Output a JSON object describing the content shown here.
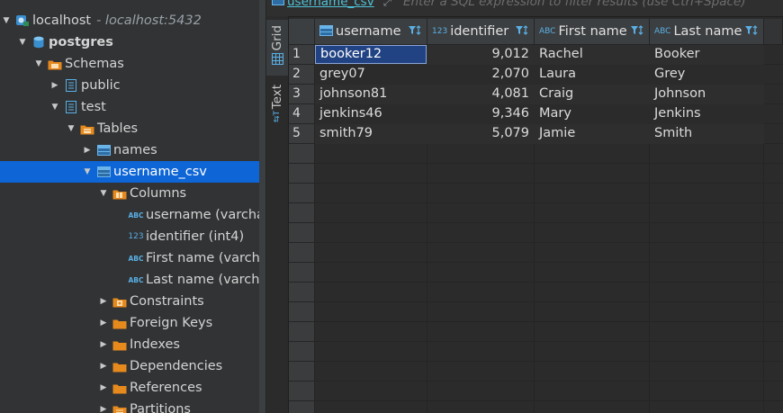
{
  "navigator": {
    "nodes": [
      {
        "label": "localhost",
        "sub": "- localhost:5432",
        "level": 0,
        "arrow": "down",
        "icon": "server-icon"
      },
      {
        "label": "postgres",
        "level": 1,
        "arrow": "down",
        "icon": "database-icon",
        "bold": true
      },
      {
        "label": "Schemas",
        "level": 2,
        "arrow": "down",
        "icon": "schemas-folder-icon"
      },
      {
        "label": "public",
        "level": 3,
        "arrow": "right",
        "icon": "schema-icon"
      },
      {
        "label": "test",
        "level": 3,
        "arrow": "down",
        "icon": "schema-icon"
      },
      {
        "label": "Tables",
        "level": 4,
        "arrow": "down",
        "icon": "tables-folder-icon"
      },
      {
        "label": "names",
        "level": 5,
        "arrow": "right",
        "icon": "table-icon"
      },
      {
        "label": "username_csv",
        "level": 5,
        "arrow": "down",
        "icon": "table-icon",
        "selected": true
      },
      {
        "label": "Columns",
        "level": 6,
        "arrow": "down",
        "icon": "columns-folder-icon"
      },
      {
        "label": "username (varchar",
        "level": 7,
        "arrow": "none",
        "icon": "text-column-icon"
      },
      {
        "label": "identifier (int4)",
        "level": 7,
        "arrow": "none",
        "icon": "number-column-icon"
      },
      {
        "label": "First name (varchar",
        "level": 7,
        "arrow": "none",
        "icon": "text-column-icon"
      },
      {
        "label": "Last name (varchar",
        "level": 7,
        "arrow": "none",
        "icon": "text-column-icon"
      },
      {
        "label": "Constraints",
        "level": 6,
        "arrow": "right",
        "icon": "constraints-folder-icon"
      },
      {
        "label": "Foreign Keys",
        "level": 6,
        "arrow": "right",
        "icon": "folder-icon"
      },
      {
        "label": "Indexes",
        "level": 6,
        "arrow": "right",
        "icon": "folder-icon"
      },
      {
        "label": "Dependencies",
        "level": 6,
        "arrow": "right",
        "icon": "folder-icon"
      },
      {
        "label": "References",
        "level": 6,
        "arrow": "right",
        "icon": "folder-icon"
      },
      {
        "label": "Partitions",
        "level": 6,
        "arrow": "right",
        "icon": "partitions-folder-icon"
      }
    ]
  },
  "editor": {
    "table_name": "username_csv",
    "filter_placeholder": "Enter a SQL expression to filter results (use Ctrl+Space)",
    "side_tabs": [
      {
        "label": "Grid",
        "icon": "grid-icon",
        "active": true
      },
      {
        "label": "Text",
        "icon": "text-icon",
        "active": false
      }
    ]
  },
  "grid": {
    "columns": [
      {
        "label": "username",
        "type_icon": "table-icon",
        "align": "left"
      },
      {
        "label": "identifier",
        "type_icon": "123",
        "align": "right"
      },
      {
        "label": "First name",
        "type_icon": "ABC",
        "align": "left"
      },
      {
        "label": "Last name",
        "type_icon": "ABC",
        "align": "left"
      }
    ],
    "rows": [
      {
        "num": "1",
        "cells": [
          "booker12",
          "9,012",
          "Rachel",
          "Booker"
        ]
      },
      {
        "num": "2",
        "cells": [
          "grey07",
          "2,070",
          "Laura",
          "Grey"
        ]
      },
      {
        "num": "3",
        "cells": [
          "johnson81",
          "4,081",
          "Craig",
          "Johnson"
        ]
      },
      {
        "num": "4",
        "cells": [
          "jenkins46",
          "9,346",
          "Mary",
          "Jenkins"
        ]
      },
      {
        "num": "5",
        "cells": [
          "smith79",
          "5,079",
          "Jamie",
          "Smith"
        ]
      }
    ],
    "selected_cell": {
      "row": 0,
      "col": 0
    },
    "colors": {
      "selection": "#214283",
      "accent": "#4fc1d6"
    }
  }
}
